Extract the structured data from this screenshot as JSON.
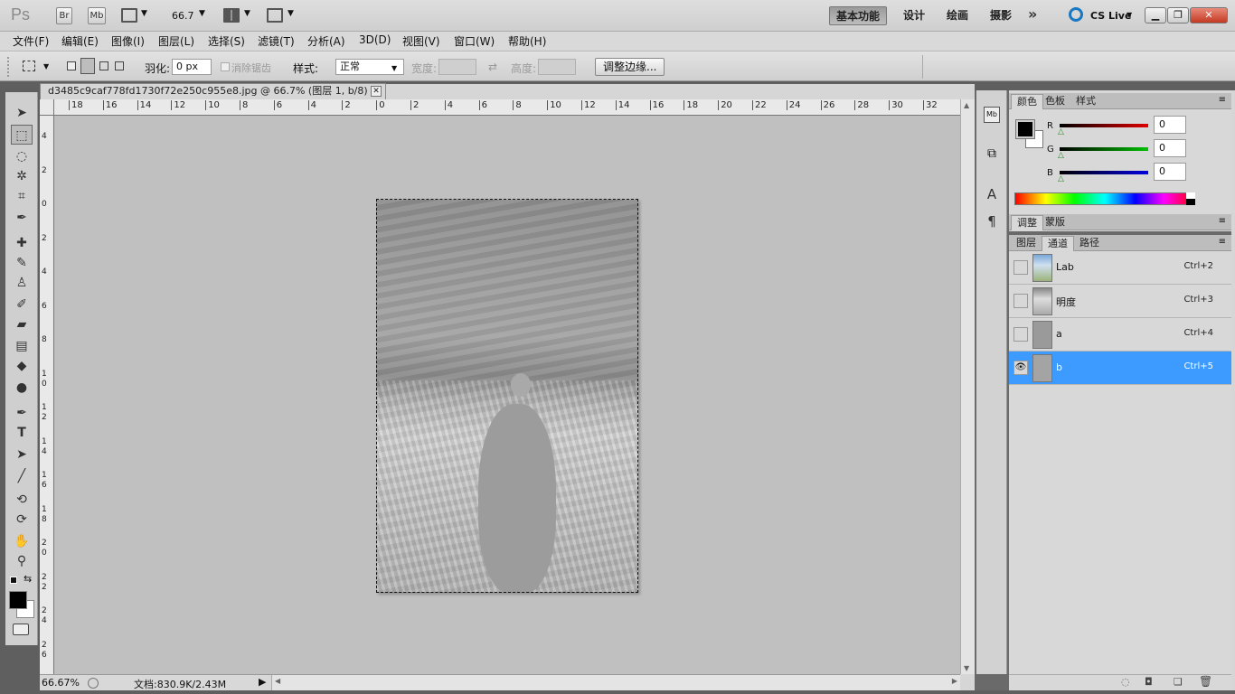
{
  "appbar": {
    "logo": "Ps",
    "bridge_btn": "Br",
    "minibridge_btn": "Mb",
    "zoom_value": "66.7",
    "workspaces": [
      "基本功能",
      "设计",
      "绘画",
      "摄影"
    ],
    "more": "»",
    "cslive": "CS Live"
  },
  "menu": [
    "文件(F)",
    "编辑(E)",
    "图像(I)",
    "图层(L)",
    "选择(S)",
    "滤镜(T)",
    "分析(A)",
    "3D(D)",
    "视图(V)",
    "窗口(W)",
    "帮助(H)"
  ],
  "options": {
    "feather_label": "羽化:",
    "feather_value": "0 px",
    "antialias_label": "消除锯齿",
    "style_label": "样式:",
    "style_value": "正常",
    "width_label": "宽度:",
    "height_label": "高度:",
    "refine_edge": "调整边缘..."
  },
  "document": {
    "tab_title": "d3485c9caf778fd1730f72e250c955e8.jpg @ 66.7% (图层 1, b/8) *",
    "hruler_labels": [
      "18",
      "16",
      "14",
      "12",
      "10",
      "8",
      "6",
      "4",
      "2",
      "0",
      "2",
      "4",
      "6",
      "8",
      "10",
      "12",
      "14",
      "16",
      "18",
      "20",
      "22",
      "24",
      "26",
      "28",
      "30",
      "32"
    ],
    "vruler_labels": [
      "4",
      "2",
      "0",
      "2",
      "4",
      "6",
      "8",
      "1\n0",
      "1\n2",
      "1\n4",
      "1\n6",
      "1\n8",
      "2\n0",
      "2\n2",
      "2\n4",
      "2\n6"
    ],
    "zoom_status": "66.67%",
    "doc_status": "文档:830.9K/2.43M"
  },
  "color_panel": {
    "tabs": [
      "颜色",
      "色板",
      "样式"
    ],
    "channels": [
      {
        "label": "R",
        "value": "0"
      },
      {
        "label": "G",
        "value": "0"
      },
      {
        "label": "B",
        "value": "0"
      }
    ]
  },
  "adjust_panel": {
    "tabs": [
      "调整",
      "蒙版"
    ]
  },
  "channels_panel": {
    "tabs": [
      "图层",
      "通道",
      "路径"
    ],
    "rows": [
      {
        "name": "Lab",
        "shortcut": "Ctrl+2",
        "visible": false,
        "selected": false
      },
      {
        "name": "明度",
        "shortcut": "Ctrl+3",
        "visible": false,
        "selected": false
      },
      {
        "name": "a",
        "shortcut": "Ctrl+4",
        "visible": false,
        "selected": false
      },
      {
        "name": "b",
        "shortcut": "Ctrl+5",
        "visible": true,
        "selected": true
      }
    ]
  },
  "colors": {
    "selection": "#3d9bff",
    "r_slider": "#e00000",
    "g_slider": "#00c000",
    "b_slider": "#0000e0"
  }
}
